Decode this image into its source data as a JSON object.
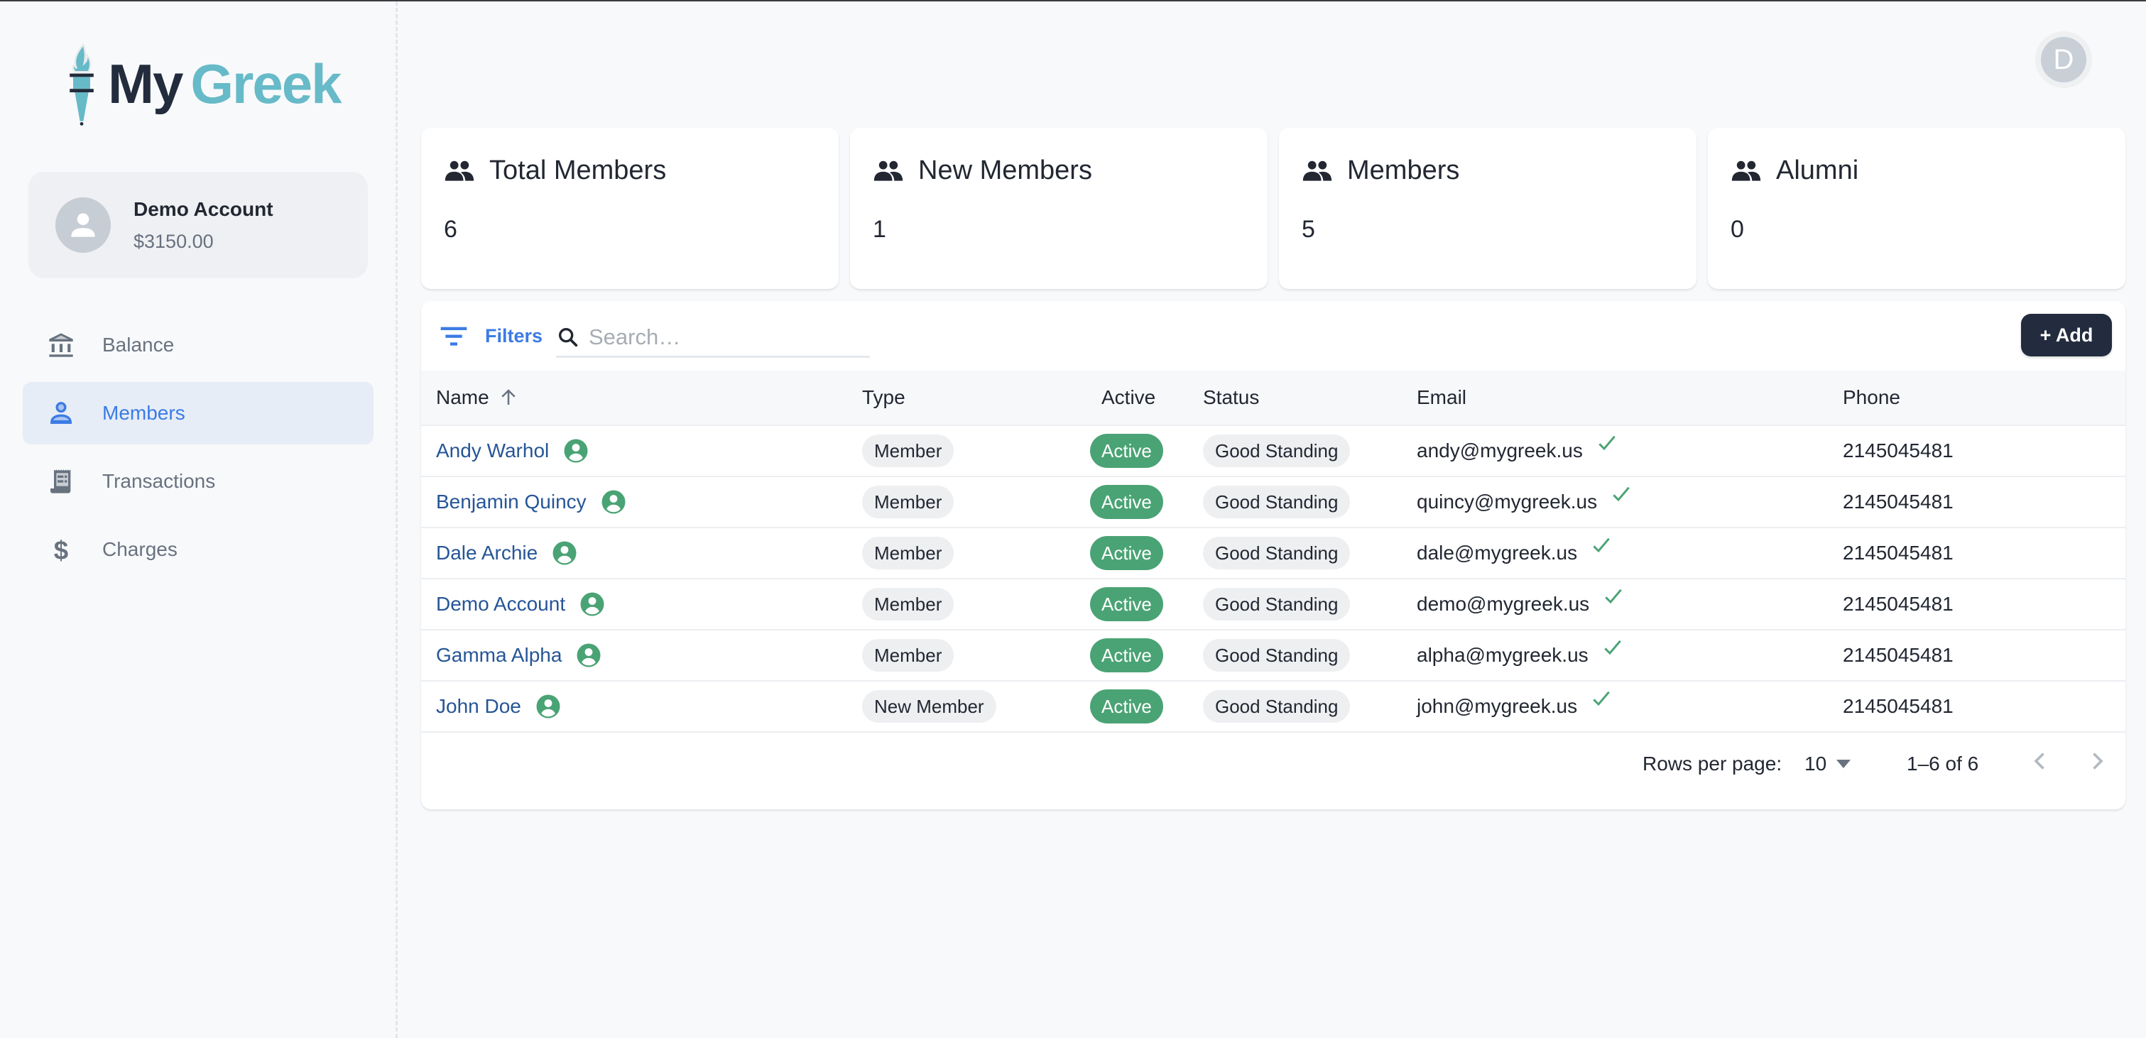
{
  "brand": {
    "part1": "My",
    "part2": "Greek",
    "accent": "#67bac8",
    "dark": "#222c3c"
  },
  "account": {
    "name": "Demo Account",
    "balance": "$3150.00"
  },
  "nav": [
    {
      "label": "Balance",
      "icon": "bank-icon",
      "active": false
    },
    {
      "label": "Members",
      "icon": "person-icon",
      "active": true
    },
    {
      "label": "Transactions",
      "icon": "receipt-icon",
      "active": false
    },
    {
      "label": "Charges",
      "icon": "dollar-icon",
      "active": false
    }
  ],
  "user_avatar": {
    "initial": "D"
  },
  "stats": [
    {
      "title": "Total Members",
      "value": "6"
    },
    {
      "title": "New Members",
      "value": "1"
    },
    {
      "title": "Members",
      "value": "5"
    },
    {
      "title": "Alumni",
      "value": "0"
    }
  ],
  "toolbar": {
    "filters_label": "Filters",
    "search_placeholder": "Search…",
    "search_value": "",
    "add_label": "+ Add"
  },
  "table": {
    "columns": {
      "name": "Name",
      "type": "Type",
      "active": "Active",
      "status": "Status",
      "email": "Email",
      "phone": "Phone"
    },
    "sort": {
      "column": "Name",
      "direction": "ascending"
    },
    "rows": [
      {
        "name": "Andy Warhol",
        "type": "Member",
        "active": "Active",
        "status": "Good Standing",
        "email": "andy@mygreek.us",
        "verified": true,
        "phone": "2145045481"
      },
      {
        "name": "Benjamin Quincy",
        "type": "Member",
        "active": "Active",
        "status": "Good Standing",
        "email": "quincy@mygreek.us",
        "verified": true,
        "phone": "2145045481"
      },
      {
        "name": "Dale Archie",
        "type": "Member",
        "active": "Active",
        "status": "Good Standing",
        "email": "dale@mygreek.us",
        "verified": true,
        "phone": "2145045481"
      },
      {
        "name": "Demo Account",
        "type": "Member",
        "active": "Active",
        "status": "Good Standing",
        "email": "demo@mygreek.us",
        "verified": true,
        "phone": "2145045481"
      },
      {
        "name": "Gamma Alpha",
        "type": "Member",
        "active": "Active",
        "status": "Good Standing",
        "email": "alpha@mygreek.us",
        "verified": true,
        "phone": "2145045481"
      },
      {
        "name": "John Doe",
        "type": "New Member",
        "active": "Active",
        "status": "Good Standing",
        "email": "john@mygreek.us",
        "verified": true,
        "phone": "2145045481"
      }
    ]
  },
  "pagination": {
    "rows_per_page_label": "Rows per page:",
    "rows_per_page": "10",
    "range": "1–6 of 6"
  },
  "colors": {
    "primary": "#3c7be5",
    "success": "#4aa374",
    "link": "#265597",
    "button_dark": "#222c3e"
  }
}
